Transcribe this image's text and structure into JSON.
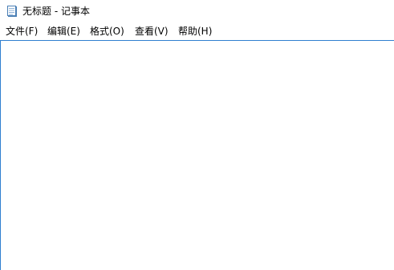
{
  "window": {
    "title": "无标题 - 记事本",
    "icon": "notepad-icon"
  },
  "menubar": {
    "items": [
      {
        "label": "文件(F)"
      },
      {
        "label": "编辑(E)"
      },
      {
        "label": "格式(O)"
      },
      {
        "label": "查看(V)"
      },
      {
        "label": "帮助(H)"
      }
    ]
  },
  "editor": {
    "content": ""
  },
  "colors": {
    "accent_border": "#2f7fd0",
    "background": "#ffffff",
    "text": "#000000"
  }
}
